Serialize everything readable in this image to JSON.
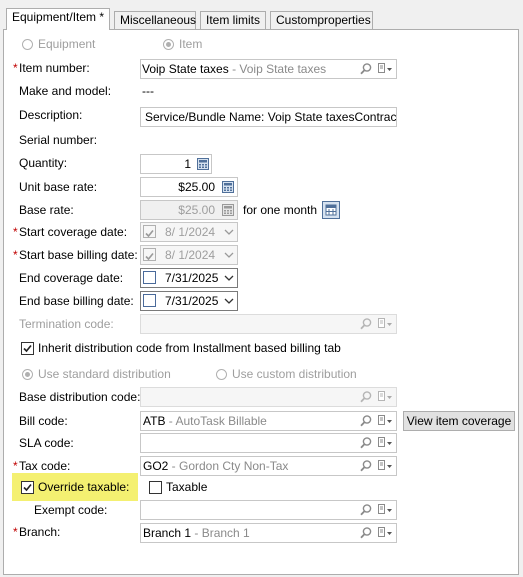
{
  "tabs": [
    {
      "label": "Equipment/Item *"
    },
    {
      "label": "Miscellaneous"
    },
    {
      "label": "Item limits"
    },
    {
      "label": "Customproperties"
    }
  ],
  "radios_top": {
    "equipment": "Equipment",
    "item": "Item"
  },
  "fields": {
    "item_number": {
      "label": "Item number:",
      "value": "Voip State taxes",
      "sub": " - Voip State taxes"
    },
    "make_model": {
      "label": "Make and model:",
      "value": "---"
    },
    "description": {
      "label": "Description:",
      "value": "Service/Bundle Name: Voip State taxesContract Nar"
    },
    "serial": {
      "label": "Serial number:"
    },
    "quantity": {
      "label": "Quantity:",
      "value": "1"
    },
    "unit_base_rate": {
      "label": "Unit base rate:",
      "value": "$25.00"
    },
    "base_rate": {
      "label": "Base rate:",
      "value": "$25.00",
      "suffix": "for one month"
    },
    "start_coverage": {
      "label": "Start coverage date:",
      "value": "8/  1/2024"
    },
    "start_billing": {
      "label": "Start base billing date:",
      "value": "8/  1/2024"
    },
    "end_coverage": {
      "label": "End coverage date:",
      "value": "7/31/2025"
    },
    "end_billing": {
      "label": "End base billing date:",
      "value": "7/31/2025"
    },
    "termination": {
      "label": "Termination code:"
    },
    "inherit": {
      "label": "Inherit distribution code from Installment based billing tab"
    },
    "use_standard": {
      "label": "Use standard distribution"
    },
    "use_custom": {
      "label": "Use custom distribution"
    },
    "base_dist": {
      "label": "Base distribution code:"
    },
    "bill_code": {
      "label": "Bill code:",
      "value": "ATB",
      "sub": " - AutoTask Billable"
    },
    "view_coverage": {
      "label": "View item coverage"
    },
    "sla_code": {
      "label": "SLA code:"
    },
    "tax_code": {
      "label": "Tax code:",
      "value": "GO2",
      "sub": " - Gordon Cty Non-Tax"
    },
    "override_taxable": {
      "label": "Override taxable:"
    },
    "taxable": {
      "label": "Taxable"
    },
    "exempt_code": {
      "label": "Exempt code:"
    },
    "branch": {
      "label": "Branch:",
      "value": "Branch 1",
      "sub": " - Branch 1"
    }
  },
  "icons": {
    "lookup": "magnifier-icon",
    "details": "details-dropdown-icon",
    "calculator": "calculator-icon",
    "calendar": "calendar-icon",
    "chevron": "chevron-down-icon"
  },
  "colors": {
    "required": "#c00000",
    "highlight": "#f4f071"
  }
}
